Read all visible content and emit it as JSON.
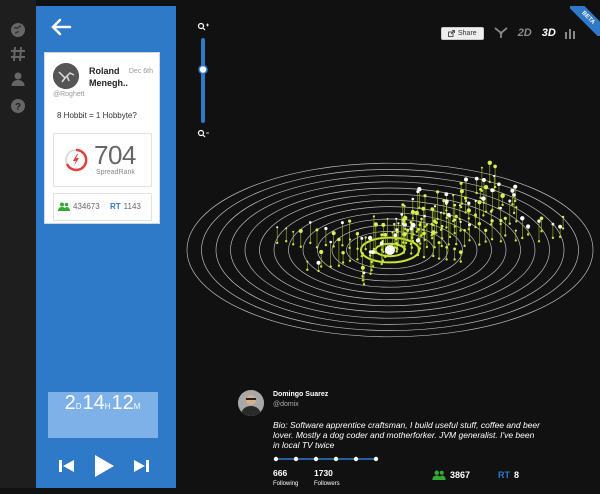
{
  "tweet_card": {
    "user_name": "Roland Menegh..",
    "date": "Dec 6th",
    "handle": "@Roghett",
    "text": "8 Hobbit = 1 Hobbyte?",
    "spread_rank": "704",
    "spread_rank_label": "SpreadRank",
    "followers": "434673",
    "rt_label": "RT",
    "retweets": "1143"
  },
  "timer": {
    "days": "2",
    "days_unit": "D",
    "hours": "14",
    "hours_unit": "H",
    "minutes": "12",
    "minutes_unit": "M"
  },
  "toolbar": {
    "share_label": "Share",
    "mode_2d": "2D",
    "mode_3d": "3D",
    "active_mode": "3D",
    "beta_label": "BETA"
  },
  "zoom": {
    "level_fraction": 0.37
  },
  "profile": {
    "name": "Domingo Suarez",
    "handle": "@domix",
    "bio": "Bio: Software apprentice craftsman, I build useful stuff, coffee and beer lover. Mostly a dog coder and motherforker. JVM generalist. I've been in local TV twice",
    "following": "666",
    "following_label": "Following",
    "followers": "1730",
    "followers_label": "Followers",
    "user_count": "3867",
    "rt_label": "RT",
    "rt_count": "8"
  },
  "colors": {
    "accent": "#2f79c9",
    "spread_green": "#c8e63a",
    "panel": "#2f79c9",
    "timer_bg": "#7db1e8"
  }
}
